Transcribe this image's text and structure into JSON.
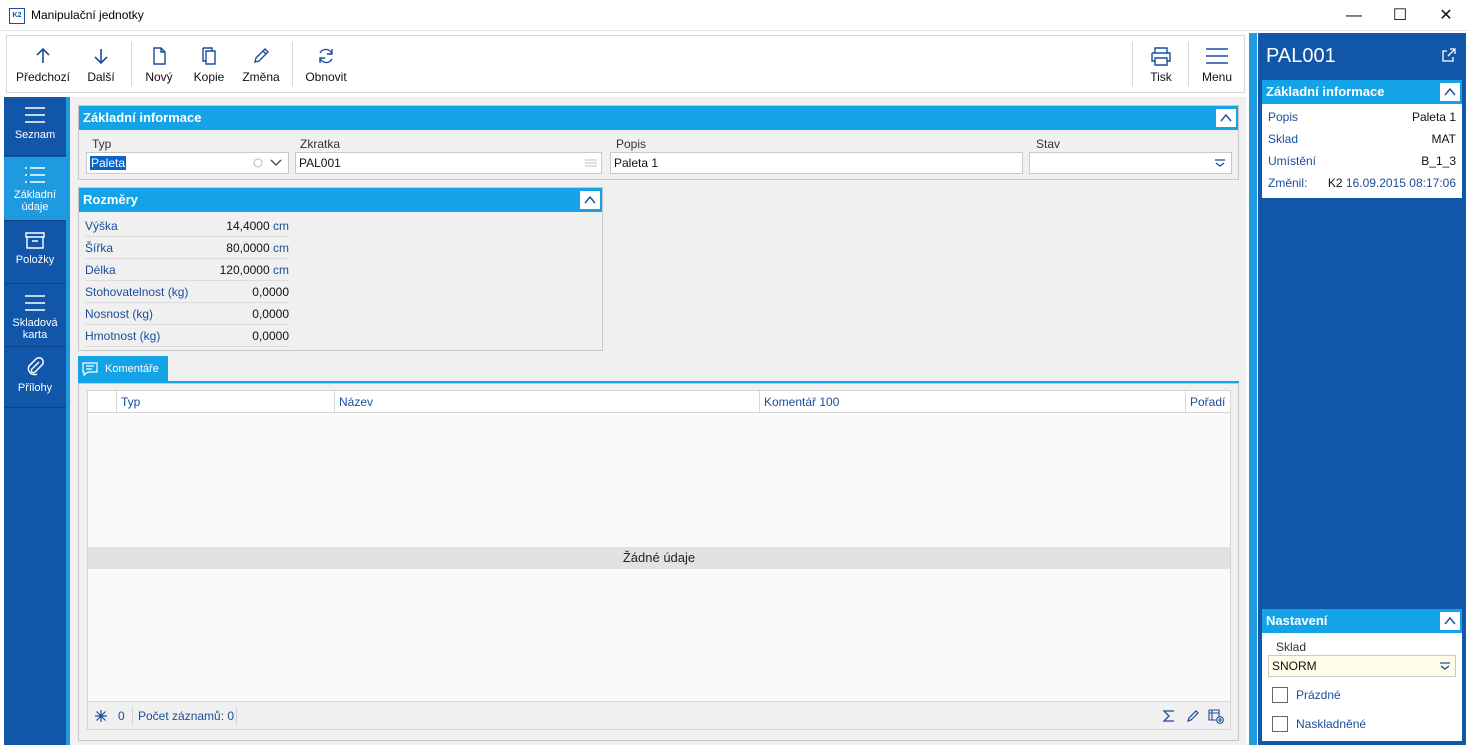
{
  "window": {
    "title": "Manipulační jednotky",
    "app_icon_text": "K2",
    "minimize_glyph": "—",
    "maximize_glyph": "☐",
    "close_glyph": "✕"
  },
  "toolbar": {
    "prev": "Předchozí",
    "next": "Další",
    "new": "Nový",
    "copy": "Kopie",
    "edit": "Změna",
    "refresh": "Obnovit",
    "print": "Tisk",
    "menu": "Menu"
  },
  "nav": {
    "items": [
      {
        "label": "Seznam"
      },
      {
        "label_line1": "Základní",
        "label_line2": "údaje"
      },
      {
        "label": "Položky"
      },
      {
        "label_line1": "Skladová",
        "label_line2": "karta"
      },
      {
        "label": "Přílohy"
      }
    ]
  },
  "basic_info": {
    "header": "Základní informace",
    "typ_label": "Typ",
    "typ_value": "Paleta",
    "zkratka_label": "Zkratka",
    "zkratka_value": "PAL001",
    "popis_label": "Popis",
    "popis_value": "Paleta 1",
    "stav_label": "Stav",
    "stav_value": ""
  },
  "dimensions": {
    "header": "Rozměry",
    "rows": [
      {
        "label": "Výška",
        "value": "14,4000",
        "unit": "cm"
      },
      {
        "label": "Šířka",
        "value": "80,0000",
        "unit": "cm"
      },
      {
        "label": "Délka",
        "value": "120,0000",
        "unit": "cm"
      },
      {
        "label": "Stohovatelnost (kg)",
        "value": "0,0000",
        "unit": ""
      },
      {
        "label": "Nosnost (kg)",
        "value": "0,0000",
        "unit": ""
      },
      {
        "label": "Hmotnost (kg)",
        "value": "0,0000",
        "unit": ""
      }
    ]
  },
  "comments_tab": {
    "label": "Komentáře"
  },
  "grid": {
    "columns": [
      "Typ",
      "Název",
      "Komentář 100",
      "Pořadí"
    ],
    "empty_text": "Žádné údaje",
    "footer_count": "0",
    "footer_records": "Počet záznamů: 0"
  },
  "right_panel": {
    "title": "PAL001",
    "info_header": "Základní informace",
    "rows": [
      {
        "label": "Popis",
        "value": "Paleta 1"
      },
      {
        "label": "Sklad",
        "value": "MAT"
      },
      {
        "label": "Umístění",
        "value": "B_1_3"
      }
    ],
    "changed_label": "Změnil:",
    "changed_user": "K2",
    "changed_date": "16.09.2015 08:17:06",
    "settings_header": "Nastavení",
    "sklad_label": "Sklad",
    "sklad_value": "SNORM",
    "empty_label": "Prázdné",
    "stocked_label": "Naskladněné"
  },
  "colors": {
    "accent": "#13a3e6",
    "nav_blue": "#1156a8",
    "label_blue": "#1a4d9a"
  }
}
